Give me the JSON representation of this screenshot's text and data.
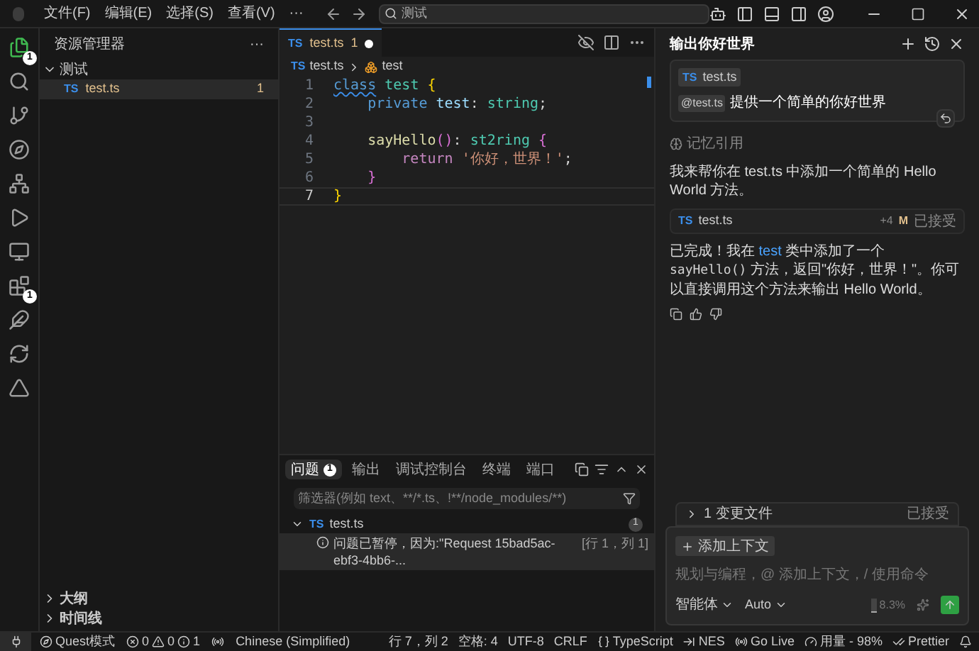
{
  "title_bar": {
    "menus": [
      "文件(F)",
      "编辑(E)",
      "选择(S)",
      "查看(V)",
      "···"
    ],
    "search": {
      "value": "测试"
    }
  },
  "activity_bar": {
    "items": [
      {
        "kind": "files",
        "badge": "1",
        "selected": true
      },
      {
        "kind": "search",
        "selected": false
      },
      {
        "kind": "branch",
        "selected": false
      },
      {
        "kind": "compass",
        "selected": false
      },
      {
        "kind": "network",
        "selected": false
      },
      {
        "kind": "run",
        "selected": false
      },
      {
        "kind": "monitor",
        "selected": false
      },
      {
        "kind": "blocks",
        "badge": "1",
        "selected": false
      },
      {
        "kind": "feather",
        "selected": false
      },
      {
        "kind": "refresh",
        "selected": false
      },
      {
        "kind": "triangle",
        "selected": false
      }
    ]
  },
  "explorer": {
    "title": "资源管理器",
    "more": "···",
    "folder": {
      "label": "测试",
      "expanded": true,
      "children": [
        {
          "icon": "TS",
          "label": "test.ts",
          "badge": "1",
          "selected": true
        }
      ]
    },
    "sections": [
      {
        "label": "大纲",
        "expanded": false
      },
      {
        "label": "时间线",
        "expanded": false
      }
    ]
  },
  "editor": {
    "tabs": [
      {
        "icon": "TS",
        "label": "test.ts",
        "badge": "1",
        "modified": true,
        "selected": true
      }
    ],
    "breadcrumb": {
      "icon": "TS",
      "file": "test.ts",
      "symbol": "test"
    },
    "lines": [
      {
        "number": "1",
        "selected": false,
        "tokens": [
          {
            "text": "class",
            "kind": "keyword",
            "squiggle": true
          },
          {
            "text": " test ",
            "kind": "class-name",
            "squiggle": false
          },
          {
            "text": "{",
            "kind": "brace",
            "squiggle": false
          }
        ]
      },
      {
        "number": "2",
        "selected": false,
        "tokens": [
          {
            "text": "    private ",
            "kind": "keyword",
            "squiggle": false
          },
          {
            "text": "test",
            "kind": "property",
            "squiggle": false
          },
          {
            "text": ": ",
            "kind": "punct",
            "squiggle": false
          },
          {
            "text": "string",
            "kind": "type",
            "squiggle": false
          },
          {
            "text": ";",
            "kind": "punct",
            "squiggle": false
          }
        ]
      },
      {
        "number": "3",
        "selected": false
      },
      {
        "number": "4",
        "selected": false,
        "tokens": [
          {
            "text": "    sayHello",
            "kind": "function",
            "squiggle": false
          },
          {
            "text": "()",
            "kind": "brace2",
            "squiggle": false
          },
          {
            "text": ": ",
            "kind": "punct",
            "squiggle": false
          },
          {
            "text": "st2ring",
            "kind": "type",
            "squiggle": false
          },
          {
            "text": " {",
            "kind": "brace2",
            "squiggle": false
          }
        ]
      },
      {
        "number": "5",
        "selected": false,
        "tokens": [
          {
            "text": "        return ",
            "kind": "control",
            "squiggle": false
          },
          {
            "text": "'你好，世界！'",
            "kind": "string",
            "squiggle": false
          },
          {
            "text": ";",
            "kind": "punct",
            "squiggle": false
          }
        ]
      },
      {
        "number": "6",
        "selected": false,
        "tokens": [
          {
            "text": "    }",
            "kind": "brace2",
            "squiggle": false
          }
        ]
      },
      {
        "number": "7",
        "selected": true,
        "tokens": [
          {
            "text": "}",
            "kind": "brace",
            "squiggle": false
          }
        ]
      }
    ]
  },
  "panel": {
    "tabs": [
      {
        "label": "问题",
        "badge": "1",
        "selected": true
      },
      {
        "label": "输出",
        "selected": false
      },
      {
        "label": "调试控制台",
        "selected": false
      },
      {
        "label": "终端",
        "selected": false
      },
      {
        "label": "端口",
        "selected": false
      }
    ],
    "filter": {
      "placeholder": "筛选器(例如 text、**/*.ts、!**/node_modules/**)"
    },
    "problems": [
      {
        "icon": "TS",
        "file": "test.ts",
        "count": "1",
        "expanded": true,
        "items": [
          {
            "message": "问题已暂停，因为:\"Request 15bad5ac-ebf3-4bb6-...",
            "location": "[行 1，列 1]",
            "selected": true
          }
        ]
      }
    ]
  },
  "chat": {
    "title": "输出你好世界",
    "user_message": {
      "file_chip": {
        "icon": "TS",
        "label": "test.ts"
      },
      "mention": "@test.ts",
      "text": "提供一个简单的你好世界"
    },
    "memory": "记忆引用",
    "intro": "我来帮你在 test.ts 中添加一个简单的 Hello World 方法。",
    "file_card": {
      "icon": "TS",
      "label": "test.ts",
      "added": "+4",
      "status": "M",
      "state": "已接受"
    },
    "answer": [
      {
        "text": "已完成！我在 ",
        "kind": "plain"
      },
      {
        "text": "test",
        "kind": "link"
      },
      {
        "text": " 类中添加了一个 ",
        "kind": "plain"
      },
      {
        "text": "sayHello()",
        "kind": "code"
      },
      {
        "text": " 方法，返回\"你好，世界！\"。你可以直接调用这个方法来输出 Hello World。",
        "kind": "plain"
      }
    ],
    "changes": {
      "label": "1 变更文件",
      "state": "已接受",
      "expanded": false
    },
    "input": {
      "add_context": "添加上下文",
      "placeholder": "规划与编程，@ 添加上下文，/ 使用命令",
      "mode": "智能体",
      "model": "Auto",
      "usage": {
        "level": 0.083,
        "reading": "8.3%"
      }
    }
  },
  "status_bar": {
    "mode": "Quest模式",
    "errors": "0",
    "warnings": "0",
    "infos": "1",
    "language_pack": "Chinese (Simplified)",
    "right": [
      {
        "kind": "text",
        "label": "行 7，列 2"
      },
      {
        "kind": "text",
        "label": "空格: 4"
      },
      {
        "kind": "text",
        "label": "UTF-8"
      },
      {
        "kind": "text",
        "label": "CRLF"
      },
      {
        "kind": "braces",
        "label": "TypeScript"
      },
      {
        "kind": "nes",
        "label": "NES"
      },
      {
        "kind": "live",
        "label": "Go Live"
      },
      {
        "kind": "usage",
        "label": "用量 - 98%"
      },
      {
        "kind": "check",
        "label": "Prettier"
      },
      {
        "kind": "bell"
      }
    ]
  }
}
